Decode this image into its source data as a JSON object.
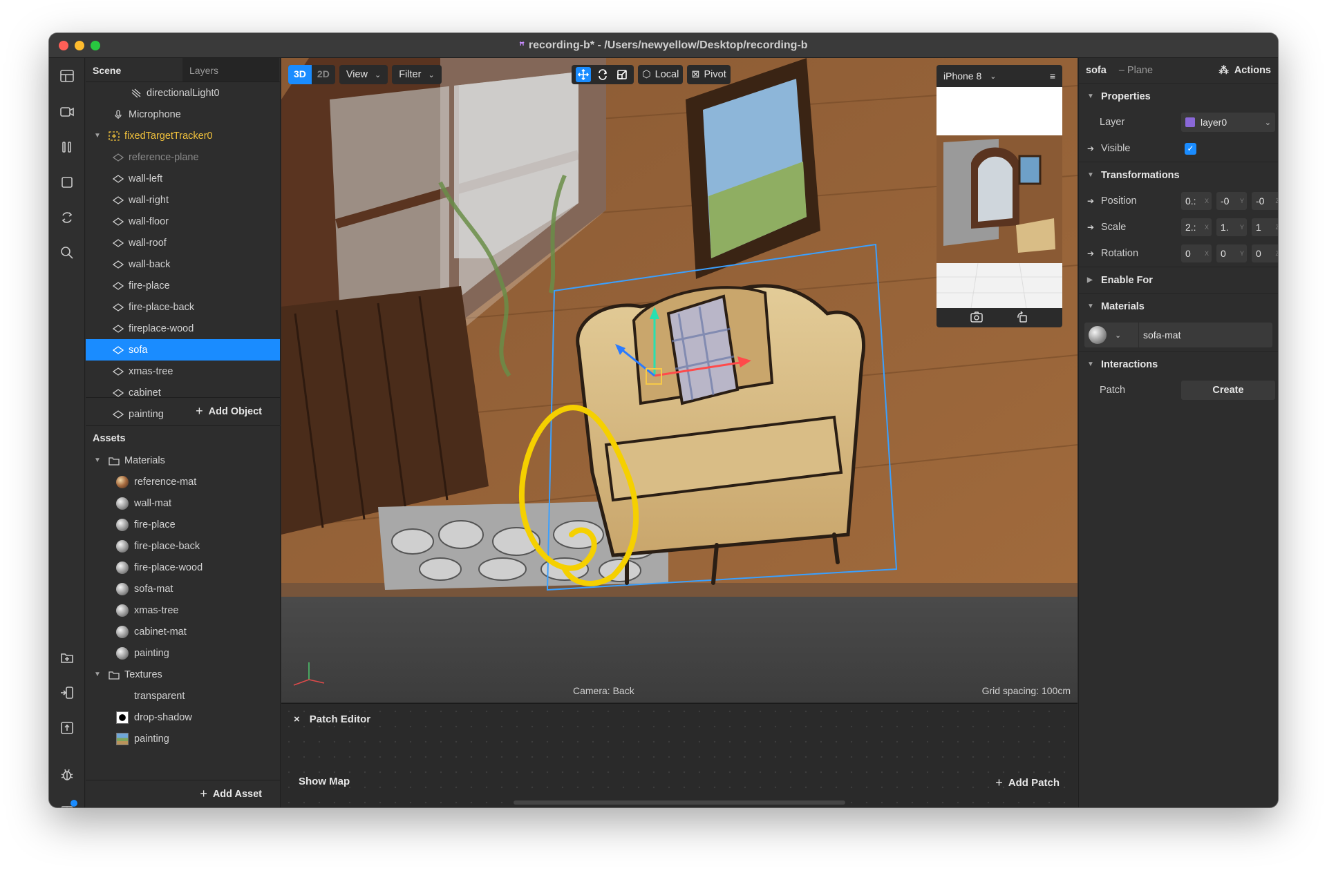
{
  "window": {
    "title": "recording-b* - /Users/newyellow/Desktop/recording-b"
  },
  "toolbar": {
    "icons": [
      "layout-icon",
      "video-icon",
      "pause-icon",
      "square-icon",
      "refresh-icon",
      "search-icon",
      "add-file-icon",
      "device-import-icon",
      "upload-icon",
      "bug-icon",
      "grid-icon"
    ]
  },
  "scene_panel": {
    "tabs": [
      "Scene",
      "Layers"
    ],
    "items": [
      {
        "label": "directionalLight0",
        "icon": "light-icon",
        "indent": 2
      },
      {
        "label": "Microphone",
        "icon": "microphone-icon",
        "indent": 1
      },
      {
        "label": "fixedTargetTracker0",
        "icon": "tracker-icon",
        "indent": 0,
        "expanded": true,
        "style": "yellow"
      },
      {
        "label": "reference-plane",
        "icon": "plane-icon",
        "indent": 1,
        "style": "dim"
      },
      {
        "label": "wall-left",
        "icon": "plane-icon",
        "indent": 1
      },
      {
        "label": "wall-right",
        "icon": "plane-icon",
        "indent": 1
      },
      {
        "label": "wall-floor",
        "icon": "plane-icon",
        "indent": 1
      },
      {
        "label": "wall-roof",
        "icon": "plane-icon",
        "indent": 1
      },
      {
        "label": "wall-back",
        "icon": "plane-icon",
        "indent": 1
      },
      {
        "label": "fire-place",
        "icon": "plane-icon",
        "indent": 1
      },
      {
        "label": "fire-place-back",
        "icon": "plane-icon",
        "indent": 1
      },
      {
        "label": "fireplace-wood",
        "icon": "plane-icon",
        "indent": 1
      },
      {
        "label": "sofa",
        "icon": "plane-icon",
        "indent": 1,
        "selected": true
      },
      {
        "label": "xmas-tree",
        "icon": "plane-icon",
        "indent": 1
      },
      {
        "label": "cabinet",
        "icon": "plane-icon",
        "indent": 1
      },
      {
        "label": "painting",
        "icon": "plane-icon",
        "indent": 1
      }
    ],
    "add_label": "Add Object"
  },
  "assets_panel": {
    "header": "Assets",
    "items": [
      {
        "label": "Materials",
        "kind": "folder",
        "indent": 0
      },
      {
        "label": "reference-mat",
        "kind": "ref-sphere",
        "indent": 1
      },
      {
        "label": "wall-mat",
        "kind": "sphere",
        "indent": 1
      },
      {
        "label": "fire-place",
        "kind": "sphere",
        "indent": 1
      },
      {
        "label": "fire-place-back",
        "kind": "sphere",
        "indent": 1
      },
      {
        "label": "fire-place-wood",
        "kind": "sphere",
        "indent": 1
      },
      {
        "label": "sofa-mat",
        "kind": "sphere",
        "indent": 1
      },
      {
        "label": "xmas-tree",
        "kind": "sphere",
        "indent": 1
      },
      {
        "label": "cabinet-mat",
        "kind": "sphere",
        "indent": 1
      },
      {
        "label": "painting",
        "kind": "sphere",
        "indent": 1
      },
      {
        "label": "Textures",
        "kind": "folder",
        "indent": 0
      },
      {
        "label": "transparent",
        "kind": "none",
        "indent": 1
      },
      {
        "label": "drop-shadow",
        "kind": "tex-black",
        "indent": 1
      },
      {
        "label": "painting",
        "kind": "tex-paint",
        "indent": 1
      }
    ],
    "add_label": "Add Asset"
  },
  "viewport": {
    "mode_3d": "3D",
    "mode_2d": "2D",
    "view_label": "View",
    "filter_label": "Filter",
    "local_label": "Local",
    "pivot_label": "Pivot",
    "camera_label": "Camera: Back",
    "grid_label": "Grid spacing: 100cm",
    "device": "iPhone 8"
  },
  "patch_editor": {
    "title": "Patch Editor",
    "show_map": "Show Map",
    "add_patch": "Add Patch"
  },
  "properties": {
    "object_name": "sofa",
    "object_type": "– Plane",
    "actions_label": "Actions",
    "sections": {
      "properties": "Properties",
      "transformations": "Transformations",
      "enable_for": "Enable For",
      "materials": "Materials",
      "interactions": "Interactions"
    },
    "layer_label": "Layer",
    "layer_value": "layer0",
    "visible_label": "Visible",
    "position_label": "Position",
    "position": [
      "0.:",
      "-0",
      "-0"
    ],
    "scale_label": "Scale",
    "scale": [
      "2.:",
      "1.",
      "1"
    ],
    "rotation_label": "Rotation",
    "rotation": [
      "0",
      "0",
      "0"
    ],
    "axis_labels": [
      "X",
      "Y",
      "Z"
    ],
    "material_value": "sofa-mat",
    "patch_label": "Patch",
    "create_label": "Create"
  },
  "colors": {
    "accent": "#1a8cff",
    "tracker": "#f2c23c",
    "layer_swatch": "#8a68d8",
    "annotation": "#f5d000"
  }
}
